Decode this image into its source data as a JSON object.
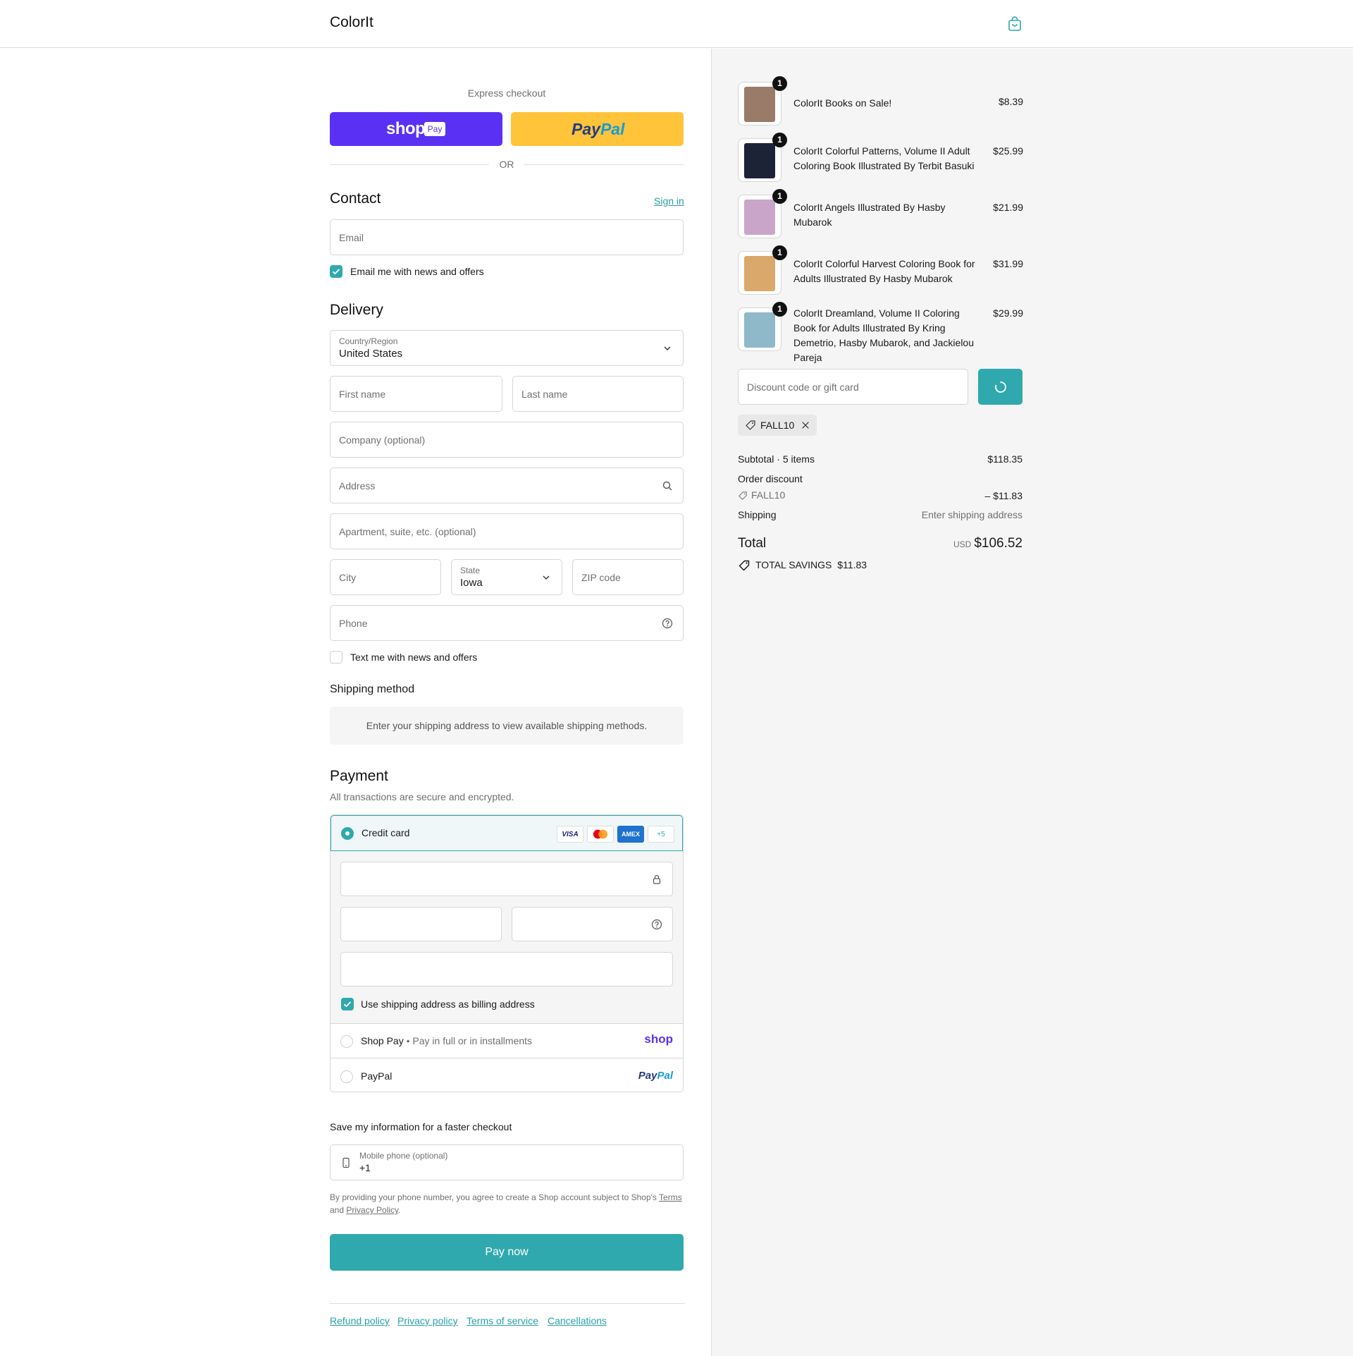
{
  "header": {
    "brand": "ColorIt"
  },
  "express": {
    "label": "Express checkout",
    "shop_pay": "shop",
    "shop_pay_badge": "Pay",
    "paypal_pay": "Pay",
    "paypal_pal": "Pal",
    "or": "OR"
  },
  "contact": {
    "title": "Contact",
    "sign_in": "Sign in",
    "email_placeholder": "Email",
    "email_opt_in": "Email me with news and offers"
  },
  "delivery": {
    "title": "Delivery",
    "country_label": "Country/Region",
    "country_value": "United States",
    "first_name": "First name",
    "last_name": "Last name",
    "company": "Company (optional)",
    "address": "Address",
    "apartment": "Apartment, suite, etc. (optional)",
    "city": "City",
    "state_label": "State",
    "state_value": "Iowa",
    "zip": "ZIP code",
    "phone": "Phone",
    "text_opt_in": "Text me with news and offers"
  },
  "shipping_method": {
    "title": "Shipping method",
    "message": "Enter your shipping address to view available shipping methods."
  },
  "payment": {
    "title": "Payment",
    "subtitle": "All transactions are secure and encrypted.",
    "credit_card": "Credit card",
    "card_badges": [
      "VISA",
      "AMEX",
      "+5"
    ],
    "billing_same": "Use shipping address as billing address",
    "shop_pay": "Shop Pay",
    "shop_pay_sep": "•",
    "shop_pay_desc": "Pay in full or in installments",
    "shop_pay_logo": "shop",
    "paypal": "PayPal",
    "paypal_logo_a": "Pay",
    "paypal_logo_b": "Pal"
  },
  "save_info": {
    "title": "Save my information for a faster checkout",
    "mobile_label": "Mobile phone (optional)",
    "mobile_value": "+1",
    "legal_prefix": "By providing your phone number, you agree to create a Shop account subject to Shop's",
    "terms": "Terms",
    "and": "and",
    "privacy": "Privacy Policy",
    "period": "."
  },
  "pay_now": "Pay now",
  "footer": {
    "links": [
      "Refund policy",
      "Privacy policy",
      "Terms of service",
      "Cancellations"
    ]
  },
  "order": {
    "items": [
      {
        "qty": "1",
        "title": "ColorIt Books on Sale!",
        "price": "$8.39",
        "thumb_color": "#9a7b6a"
      },
      {
        "qty": "1",
        "title": "ColorIt Colorful Patterns, Volume II Adult Coloring Book Illustrated By Terbit Basuki",
        "price": "$25.99",
        "thumb_color": "#1d2337"
      },
      {
        "qty": "1",
        "title": "ColorIt Angels Illustrated By Hasby Mubarok",
        "price": "$21.99",
        "thumb_color": "#c9a6c9"
      },
      {
        "qty": "1",
        "title": "ColorIt Colorful Harvest Coloring Book for Adults Illustrated By Hasby Mubarok",
        "price": "$31.99",
        "thumb_color": "#d9a86a"
      },
      {
        "qty": "1",
        "title": "ColorIt Dreamland, Volume II Coloring Book for Adults Illustrated By Kring Demetrio, Hasby Mubarok, and Jackielou Pareja",
        "price": "$29.99",
        "thumb_color": "#8fb8c9"
      }
    ],
    "discount_placeholder": "Discount code or gift card",
    "applied_code": "FALL10",
    "subtotal_label": "Subtotal · 5 items",
    "subtotal_value": "$118.35",
    "order_discount_label": "Order discount",
    "discount_code": "FALL10",
    "discount_value": "– $11.83",
    "shipping_label": "Shipping",
    "shipping_value": "Enter shipping address",
    "total_label": "Total",
    "currency": "USD",
    "total_value": "$106.52",
    "savings_label": "TOTAL SAVINGS",
    "savings_value": "$11.83"
  },
  "colors": {
    "accent": "#2fa9ae",
    "shop_pay": "#5a31f4",
    "paypal": "#ffc439"
  }
}
